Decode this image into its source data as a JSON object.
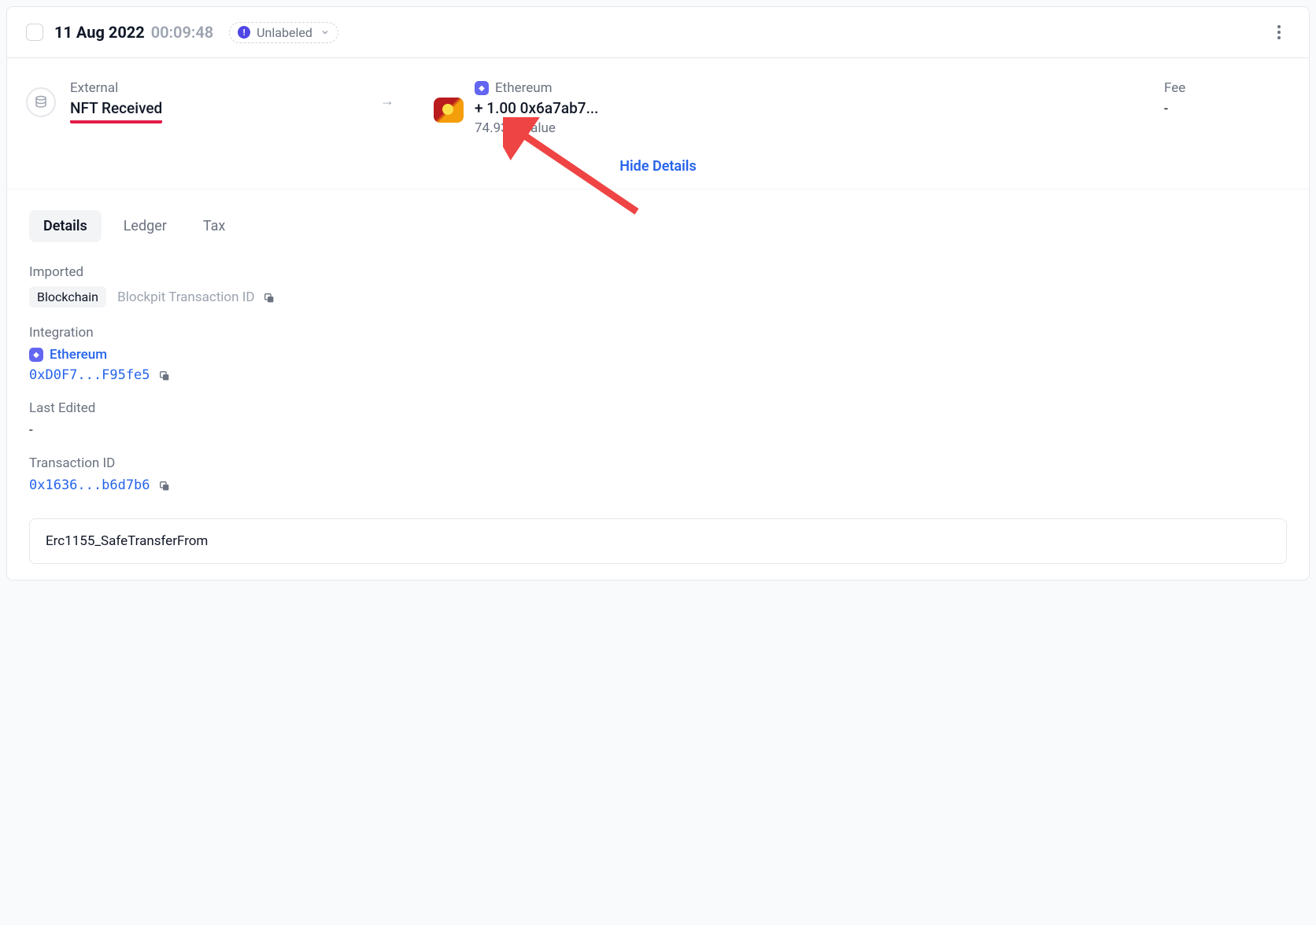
{
  "header": {
    "date": "11 Aug 2022",
    "time": "00:09:48",
    "label_status": "Unlabeled"
  },
  "transaction": {
    "source_type": "External",
    "action": "NFT Received",
    "chain": "Ethereum",
    "amount_text": "+ 1.00 0x6a7ab7...",
    "value_text": "74.93 $ Value",
    "fee_label": "Fee",
    "fee_value": "-",
    "toggle": "Hide Details"
  },
  "tabs": {
    "details": "Details",
    "ledger": "Ledger",
    "tax": "Tax"
  },
  "details": {
    "imported_label": "Imported",
    "imported_pill": "Blockchain",
    "imported_text": "Blockpit Transaction ID",
    "integration_label": "Integration",
    "integration_chain": "Ethereum",
    "integration_address": "0xD0F7...F95fe5",
    "last_edited_label": "Last Edited",
    "last_edited_value": "-",
    "txid_label": "Transaction ID",
    "txid_value": "0x1636...b6d7b6",
    "method_name": "Erc1155_SafeTransferFrom"
  }
}
